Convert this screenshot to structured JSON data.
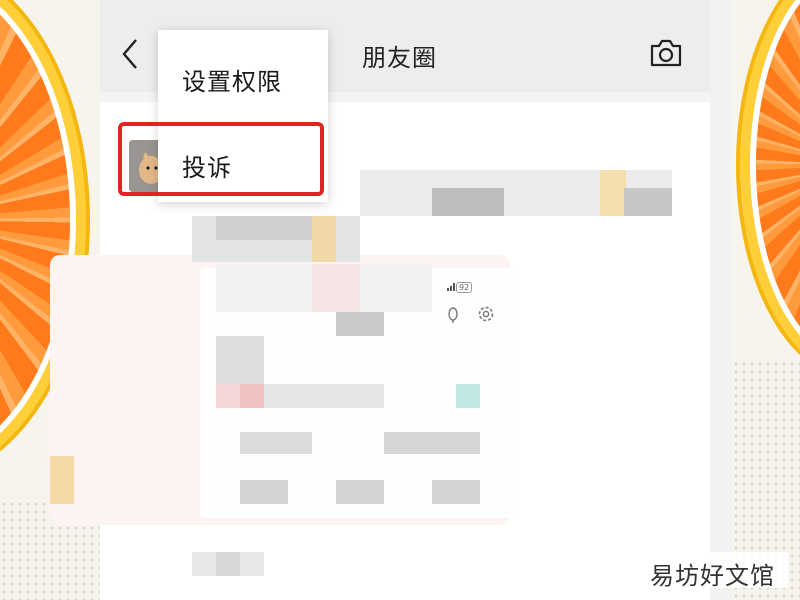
{
  "header": {
    "title": "朋友圈",
    "back_icon": "chevron-left-icon",
    "camera_icon": "camera-icon"
  },
  "menu": {
    "items": [
      {
        "label": "设置权限"
      },
      {
        "label": "投诉"
      }
    ],
    "highlight_color": "#e02424"
  },
  "embedded_status": {
    "battery": "92"
  },
  "watermark": {
    "text": "易坊好文馆"
  },
  "colors": {
    "header_bg": "#ededed",
    "orange": "#ff7a1a",
    "rind": "#ffcf3a"
  }
}
